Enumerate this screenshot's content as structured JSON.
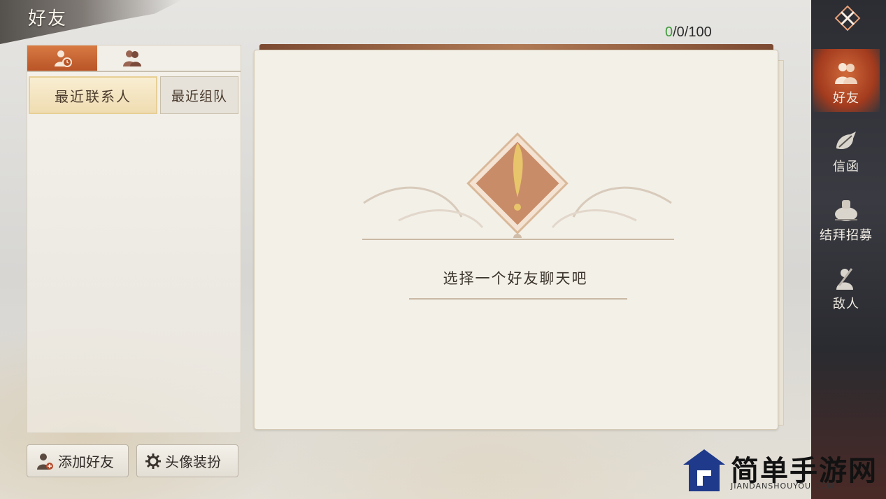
{
  "page": {
    "title": "好友"
  },
  "counter": {
    "online": "0",
    "rest": "/0/100"
  },
  "left_panel": {
    "tabs": [
      {
        "icon": "recent-contacts-icon",
        "active": true
      },
      {
        "icon": "friends-group-icon",
        "active": false
      }
    ],
    "sub_tabs": [
      {
        "label": "最近联系人",
        "active": true
      },
      {
        "label": "最近组队",
        "active": false
      }
    ]
  },
  "buttons": {
    "add_friend": "添加好友",
    "avatar_dress": "头像装扮"
  },
  "main": {
    "empty_message": "选择一个好友聊天吧"
  },
  "nav": {
    "items": [
      {
        "label": "好友",
        "icon": "friends-icon",
        "active": true
      },
      {
        "label": "信函",
        "icon": "letter-icon",
        "active": false
      },
      {
        "label": "结拜招募",
        "icon": "sworn-recruit-icon",
        "active": false
      },
      {
        "label": "敌人",
        "icon": "enemy-icon",
        "active": false
      }
    ]
  },
  "watermark": {
    "title": "简单手游网",
    "subtitle": "JIANDANSHOUYOU.COM"
  },
  "colors": {
    "accent": "#c0602e",
    "online_green": "#3e9a3a",
    "panel_bg": "#f3f0e8"
  }
}
